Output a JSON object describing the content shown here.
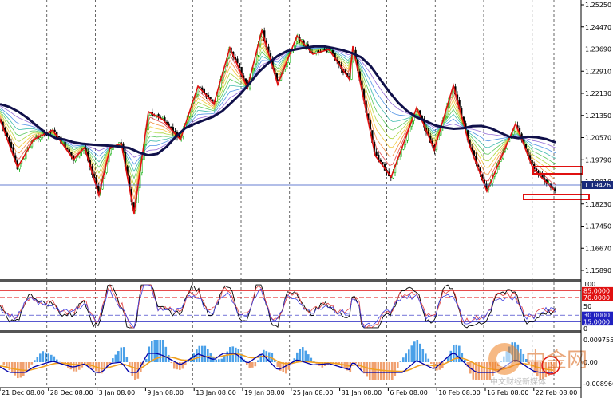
{
  "chart_data": {
    "type": "line",
    "instrument_note": "",
    "main_panel": {
      "price_ticks": [
        "1.25250",
        "1.24470",
        "1.23690",
        "1.22910",
        "1.22130",
        "1.21350",
        "1.20570",
        "1.19790",
        "1.19010",
        "1.18230",
        "1.17450",
        "1.16670",
        "1.15890"
      ],
      "current_price": "1.19426",
      "ylim": [
        1.1589,
        1.2525
      ],
      "series": [
        {
          "name": "",
          "values": [
            1.2175,
            1.2165,
            1.2148,
            1.2125,
            1.2098,
            1.2072,
            1.2055,
            1.205,
            1.204,
            1.2035,
            1.2032,
            1.203,
            1.2028,
            1.2025,
            1.202,
            1.2005,
            1.1995,
            1.2,
            1.2025,
            1.206,
            1.209,
            1.2105,
            1.2118,
            1.213,
            1.215,
            1.218,
            1.2212,
            1.225,
            1.229,
            1.232,
            1.2345,
            1.2362,
            1.2368,
            1.2374,
            1.2378,
            1.2378,
            1.2372,
            1.2365,
            1.2355,
            1.234,
            1.231,
            1.2265,
            1.222,
            1.218,
            1.215,
            1.2128,
            1.2115,
            1.21,
            1.2092,
            1.2088,
            1.209,
            1.2097,
            1.2098,
            1.209,
            1.2075,
            1.206,
            1.2055,
            1.206,
            1.2058,
            1.2052,
            1.204
          ]
        }
      ]
    },
    "rsi_panel": {
      "labels": [
        "100",
        "85.0000",
        "70.0000",
        "50",
        "30.0000",
        "15.0000",
        "0"
      ],
      "levels": [
        85,
        70,
        30,
        15
      ]
    },
    "macd_panel": {
      "labels": [
        "0.0097556",
        "0.00",
        "-0.008966"
      ]
    },
    "x_ticks": [
      "21 Dec 08:00",
      "28 Dec 08:00",
      "3 Jan 08:00",
      "9 Jan 08:00",
      "13 Jan 08:00",
      "19 Jan 08:00",
      "25 Jan 08:00",
      "31 Jan 08:00",
      "6 Feb 08:00",
      "10 Feb 08:00",
      "16 Feb 08:00",
      "22 Feb 08:00"
    ]
  },
  "watermark": {
    "brand": "中金网",
    "sub": "中文财经新媒体"
  },
  "colors": {
    "ma_main": "#10104a",
    "zigzag": "#e01010",
    "up_candle": "#00aa00",
    "rsi_line1": "#000000",
    "rsi_line2": "#e04040",
    "rsi_line3": "#4040e0",
    "macd_pos": "#4aa0e8",
    "macd_neg": "#f0a070",
    "macd_line": "#f0a020",
    "signal_line": "#0000aa"
  }
}
